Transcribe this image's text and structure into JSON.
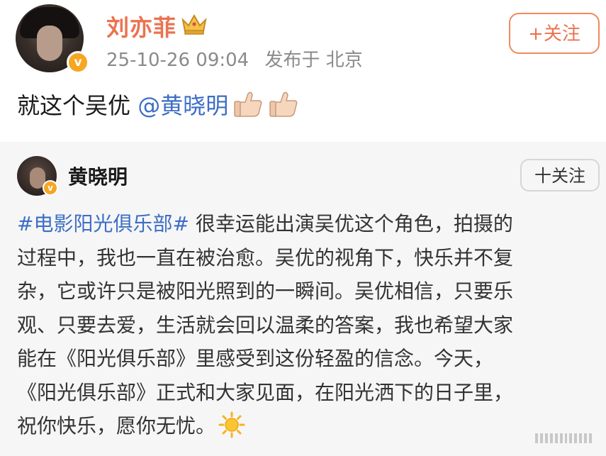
{
  "post": {
    "username": "刘亦菲",
    "timestamp": "25-10-26 09:04",
    "location": "发布于 北京",
    "follow_label": "+关注",
    "text_prefix": "就这个吴优 ",
    "mention": "@黄晓明",
    "reaction_icons": [
      "thumbs-up-icon",
      "thumbs-up-icon"
    ],
    "badge_icon": "crown-icon"
  },
  "repost": {
    "username": "黄晓明",
    "follow_label": "十关注",
    "hashtag": "#电影阳光俱乐部#",
    "lines": [
      " 很幸运能出演吴优这个角色，拍摄的",
      "过程中，我也一直在被治愈。吴优的视角下，快乐并不复",
      "杂，它或许只是被阳光照到的一瞬间。吴优相信，只要乐",
      "观、只要去爱，生活就会回以温柔的答案，我也希望大家",
      "能在《阳光俱乐部》里感受到这份轻盈的信念。今天，",
      "《阳光俱乐部》正式和大家见面，在阳光洒下的日子里，",
      "祝你快乐，愿你无忧。"
    ],
    "end_icon": "sun-icon"
  },
  "colors": {
    "username": "#eb7350",
    "link": "#3c6ec4",
    "verified": "#f5a623",
    "meta": "#8a8a8a",
    "repost_bg": "#f6f6f6"
  }
}
